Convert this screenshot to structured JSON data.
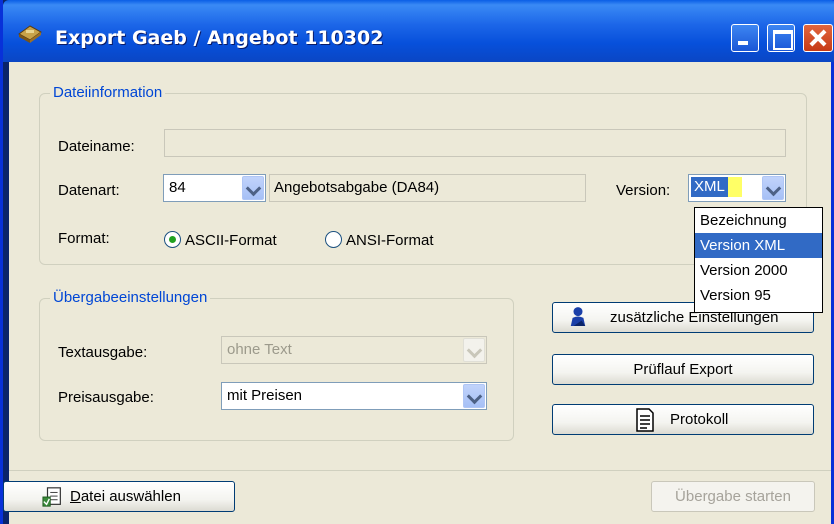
{
  "window": {
    "title": "Export Gaeb / Angebot 110302"
  },
  "dateiinformation": {
    "group_title": "Dateiinformation",
    "dateiname_label": "Dateiname:",
    "dateiname_value": "",
    "datenart_label": "Datenart:",
    "datenart_value": "84",
    "datenart_description": "Angebotsabgabe (DA84)",
    "version_label": "Version:",
    "version_value": "XML",
    "format_label": "Format:",
    "format_options": [
      "ASCII-Format",
      "ANSI-Format"
    ],
    "format_selected": "ASCII-Format"
  },
  "version_dropdown": {
    "items": [
      "Bezeichnung",
      "Version XML",
      "Version 2000",
      "Version 95"
    ],
    "selected": "Version XML"
  },
  "uebergabe": {
    "group_title": "Übergabeeinstellungen",
    "textausgabe_label": "Textausgabe:",
    "textausgabe_value": "ohne Text",
    "preisausgabe_label": "Preisausgabe:",
    "preisausgabe_value": "mit Preisen"
  },
  "buttons": {
    "zusaetzliche": "zusätzliche Einstellungen",
    "prueflauf": "Prüflauf Export",
    "protokoll": "Protokoll",
    "datei_prefix": "D",
    "datei_rest": "atei auswählen",
    "uebergabe_starten": "Übergabe starten"
  },
  "colors": {
    "titlebar": "#0a5ee6",
    "window_bg": "#ece9d8",
    "group_title": "#0046d5",
    "selection": "#316ac5"
  },
  "icons": [
    "window-app-icon",
    "minimize-icon",
    "maximize-icon",
    "close-icon",
    "user-settings-icon",
    "document-icon",
    "file-select-icon"
  ]
}
